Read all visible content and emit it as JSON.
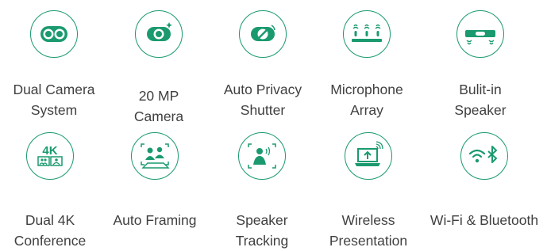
{
  "accent_color": "#1a9a6e",
  "features": [
    {
      "icon": "dual-camera-icon",
      "label": [
        "Dual Camera",
        "System"
      ]
    },
    {
      "icon": "camera-icon",
      "label": [
        "20 MP",
        "Camera"
      ]
    },
    {
      "icon": "privacy-shutter-icon",
      "label": [
        "Auto Privacy",
        "Shutter"
      ]
    },
    {
      "icon": "microphone-array-icon",
      "label": [
        "Microphone",
        "Array"
      ]
    },
    {
      "icon": "speaker-bar-icon",
      "label": [
        "Bulit-in",
        "Speaker"
      ]
    },
    {
      "icon": "dual-4k-icon",
      "icon_text": "4K",
      "label": [
        "Dual 4K",
        "Conference"
      ]
    },
    {
      "icon": "auto-framing-icon",
      "label": [
        "Auto Framing",
        ""
      ]
    },
    {
      "icon": "speaker-tracking-icon",
      "label": [
        "Speaker",
        "Tracking"
      ]
    },
    {
      "icon": "wireless-presentation-icon",
      "label": [
        "Wireless",
        "Presentation"
      ]
    },
    {
      "icon": "wifi-bluetooth-icon",
      "label": [
        "Wi-Fi & Bluetooth",
        ""
      ]
    }
  ]
}
